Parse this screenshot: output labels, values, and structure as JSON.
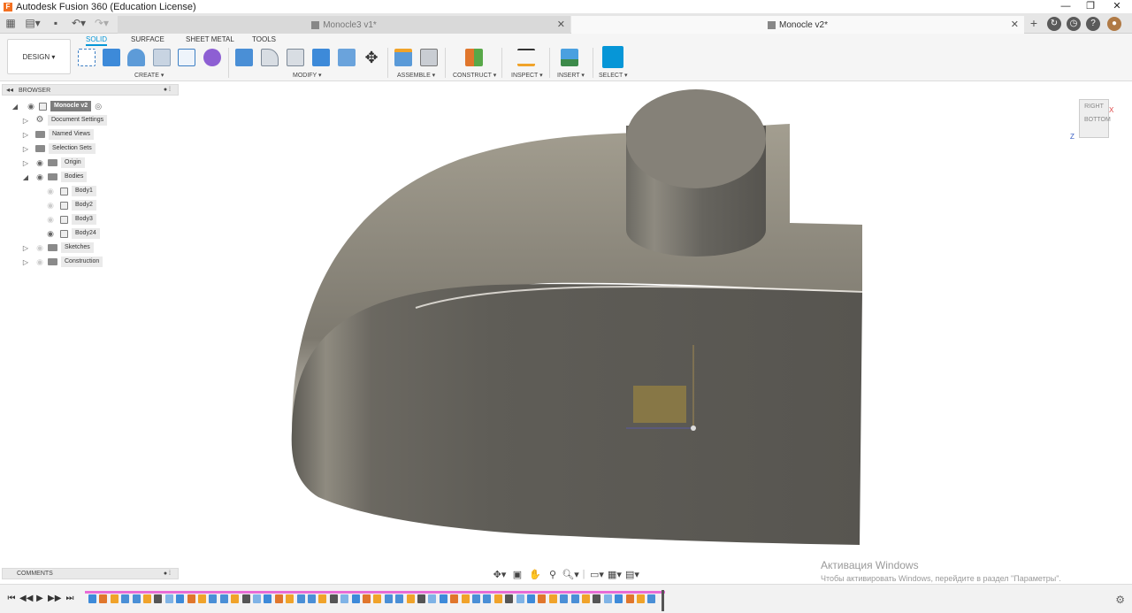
{
  "window": {
    "title": "Autodesk Fusion 360 (Education License)",
    "logo": "F",
    "controls": [
      "—",
      "❐",
      "✕"
    ]
  },
  "tabs": [
    {
      "label": "Monocle3 v1*",
      "active": false
    },
    {
      "label": "Monocle v2*",
      "active": true
    }
  ],
  "toolbar": {
    "design_label": "DESIGN ▾",
    "workspace_tabs": [
      "SOLID",
      "SURFACE",
      "SHEET METAL",
      "TOOLS"
    ],
    "groups": {
      "create": "CREATE ▾",
      "modify": "MODIFY ▾",
      "assemble": "ASSEMBLE ▾",
      "construct": "CONSTRUCT ▾",
      "inspect": "INSPECT ▾",
      "insert": "INSERT ▾",
      "select": "SELECT ▾"
    }
  },
  "browser": {
    "header": "BROWSER",
    "items": [
      {
        "label": "Monocle v2",
        "level": 0
      },
      {
        "label": "Document Settings",
        "level": 1
      },
      {
        "label": "Named Views",
        "level": 1
      },
      {
        "label": "Selection Sets",
        "level": 1
      },
      {
        "label": "Origin",
        "level": 1
      },
      {
        "label": "Bodies",
        "level": 1
      },
      {
        "label": "Body1",
        "level": 2
      },
      {
        "label": "Body2",
        "level": 2
      },
      {
        "label": "Body3",
        "level": 2
      },
      {
        "label": "Body24",
        "level": 2
      },
      {
        "label": "Sketches",
        "level": 1
      },
      {
        "label": "Construction",
        "level": 1
      }
    ]
  },
  "viewcube": {
    "face_top": "RIGHT",
    "face_front": "BOTTOM",
    "axis_z": "Z",
    "axis_x": "X"
  },
  "comments": {
    "header": "COMMENTS"
  },
  "activation": {
    "title": "Активация Windows",
    "text": "Чтобы активировать Windows, перейдите в раздел \"Параметры\"."
  },
  "colors": {
    "accent": "#0696d7",
    "model": "#6e6b64",
    "timeline_track": "#e86cd6",
    "sketch_box": "#8c7a45"
  }
}
